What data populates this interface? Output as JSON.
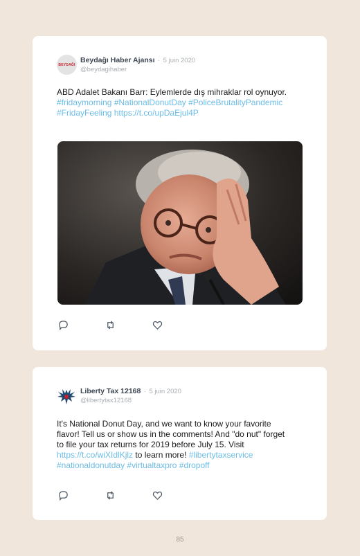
{
  "tweets": [
    {
      "author": "Beydağı Haber Ajansı",
      "avatar_text": "BEYDAĞI",
      "separator": "·",
      "date": "5 juin 2020",
      "handle": "@beydagihaber",
      "text_plain": "ABD Adalet Bakanı Barr: Eylemlerde dış mihraklar rol oynuyor.",
      "hashtags": "#fridaymorning #NationalDonutDay #PoliceBrutalityPandemic #FridayFeeling",
      "link": "https://t.co/upDaEjul4P",
      "icons": [
        "reply-icon",
        "retweet-icon",
        "like-icon"
      ]
    },
    {
      "author": "Liberty Tax 12168",
      "separator": "·",
      "date": "5 juin 2020",
      "handle": "@libertytax12168",
      "text_plain": "It's National Donut Day, and we want to know your favorite flavor! Tell us or show us in the comments! And \"do nut\" forget to file your tax returns for 2019 before July 15. Visit",
      "link": "https://t.co/wiXIdlKjlz",
      "text_after_link": "to learn more!",
      "hashtags": "#libertytaxservice #nationaldonutday #virtualtaxpro #dropoff",
      "icons": [
        "reply-icon",
        "retweet-icon",
        "like-icon"
      ]
    }
  ],
  "page_number": "85",
  "colors": {
    "background": "#f0e6dc",
    "card": "#ffffff",
    "link": "#6bbde8",
    "author": "#3b4651",
    "muted": "#a8aeb3"
  }
}
